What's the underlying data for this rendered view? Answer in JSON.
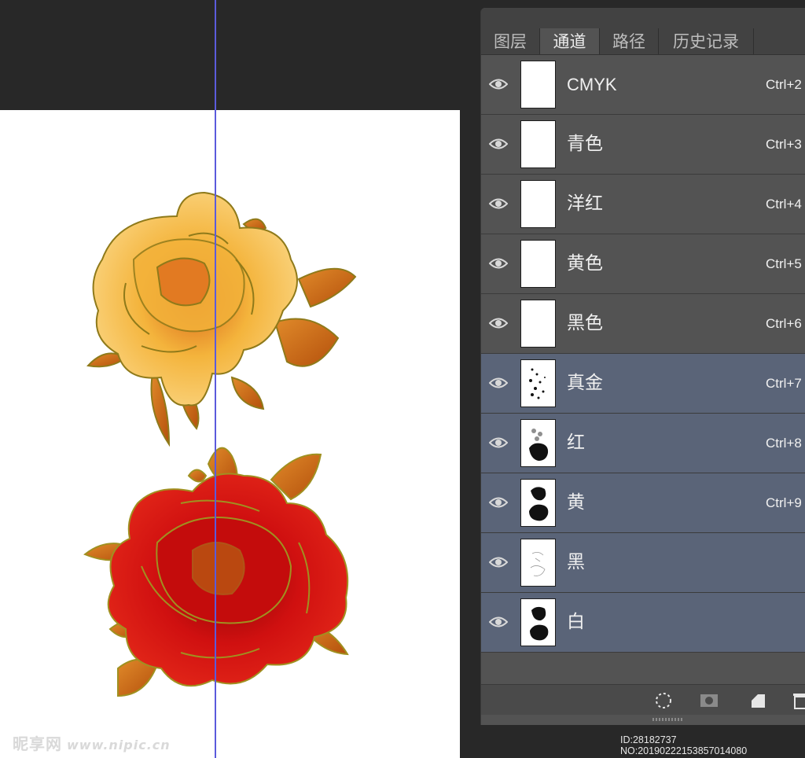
{
  "panel": {
    "tabs": [
      {
        "label": "图层",
        "active": false
      },
      {
        "label": "通道",
        "active": true
      },
      {
        "label": "路径",
        "active": false
      },
      {
        "label": "历史记录",
        "active": false
      }
    ],
    "channels": [
      {
        "name": "CMYK",
        "shortcut": "Ctrl+2",
        "selected": false
      },
      {
        "name": "青色",
        "shortcut": "Ctrl+3",
        "selected": false
      },
      {
        "name": "洋红",
        "shortcut": "Ctrl+4",
        "selected": false
      },
      {
        "name": "黄色",
        "shortcut": "Ctrl+5",
        "selected": false
      },
      {
        "name": "黑色",
        "shortcut": "Ctrl+6",
        "selected": false
      },
      {
        "name": "真金",
        "shortcut": "Ctrl+7",
        "selected": true
      },
      {
        "name": "红",
        "shortcut": "Ctrl+8",
        "selected": true
      },
      {
        "name": "黄",
        "shortcut": "Ctrl+9",
        "selected": true
      },
      {
        "name": "黑",
        "shortcut": "",
        "selected": true
      },
      {
        "name": "白",
        "shortcut": "",
        "selected": true
      }
    ],
    "bottom_buttons": [
      "load-selection-icon",
      "save-selection-icon",
      "new-channel-icon",
      "delete-channel-icon"
    ]
  },
  "watermark": {
    "brand": "昵享网",
    "url": "www.nipic.cn"
  },
  "id_stamp": "ID:28182737 NO:20190222153857014080",
  "colors": {
    "selected_row": "#5a6478",
    "panel_bg": "#535353",
    "guide": "#5b5bdc",
    "gold_petal": "#f2b43a",
    "red_petal": "#d10f0f",
    "leaf": "#c8620f"
  }
}
